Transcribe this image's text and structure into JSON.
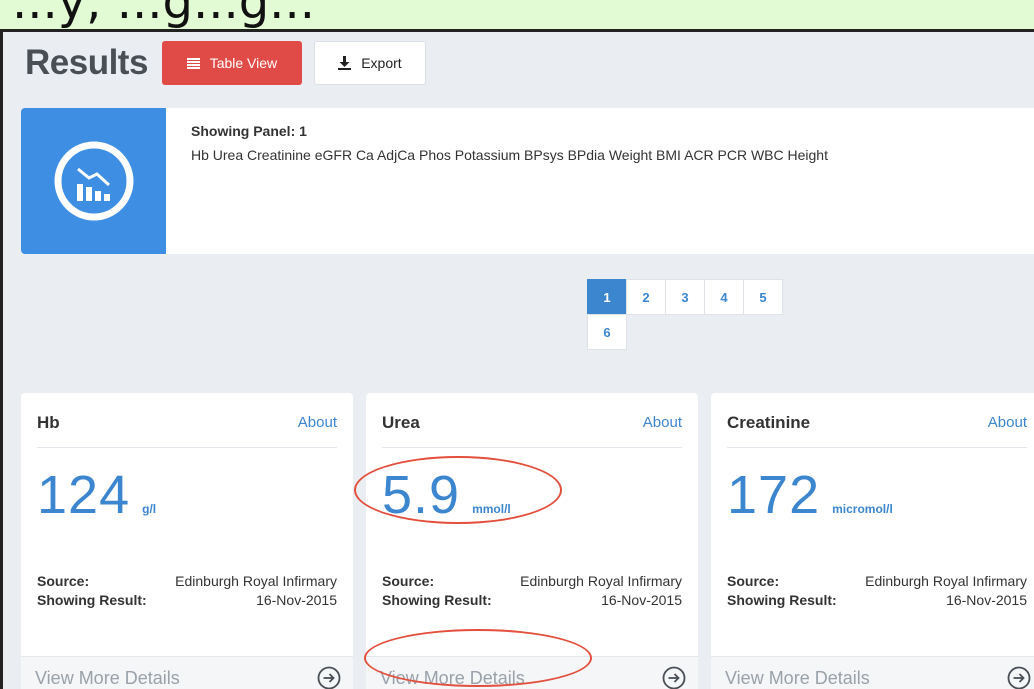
{
  "caption": "...y, ...g...g...",
  "header": {
    "title": "Results",
    "table_view_label": "Table View",
    "export_label": "Export"
  },
  "panel": {
    "heading": "Showing Panel: 1",
    "items": "Hb Urea Creatinine eGFR Ca AdjCa Phos Potassium BPsys BPdia Weight BMI ACR PCR WBC Height",
    "icon": "chart-trend-icon"
  },
  "pagination": {
    "pages": [
      "1",
      "2",
      "3",
      "4",
      "5",
      "6"
    ],
    "active": "1"
  },
  "cards": [
    {
      "title": "Hb",
      "about": "About",
      "value": "124",
      "unit": "g/l",
      "source_label": "Source:",
      "source": "Edinburgh Royal Infirmary",
      "result_label": "Showing Result:",
      "result_date": "16-Nov-2015",
      "footer": "View More Details"
    },
    {
      "title": "Urea",
      "about": "About",
      "value": "5.9",
      "unit": "mmol/l",
      "source_label": "Source:",
      "source": "Edinburgh Royal Infirmary",
      "result_label": "Showing Result:",
      "result_date": "16-Nov-2015",
      "footer": "View More Details"
    },
    {
      "title": "Creatinine",
      "about": "About",
      "value": "172",
      "unit": "micromol/l",
      "source_label": "Source:",
      "source": "Edinburgh Royal Infirmary",
      "result_label": "Showing Result:",
      "result_date": "16-Nov-2015",
      "footer": "View More Details"
    }
  ],
  "colors": {
    "accent_blue": "#3c86d0",
    "table_view_red": "#e04b47",
    "panel_icon_blue": "#3e8fe3",
    "annotation_red": "#e34f3d",
    "page_background": "#e3fbd5"
  }
}
